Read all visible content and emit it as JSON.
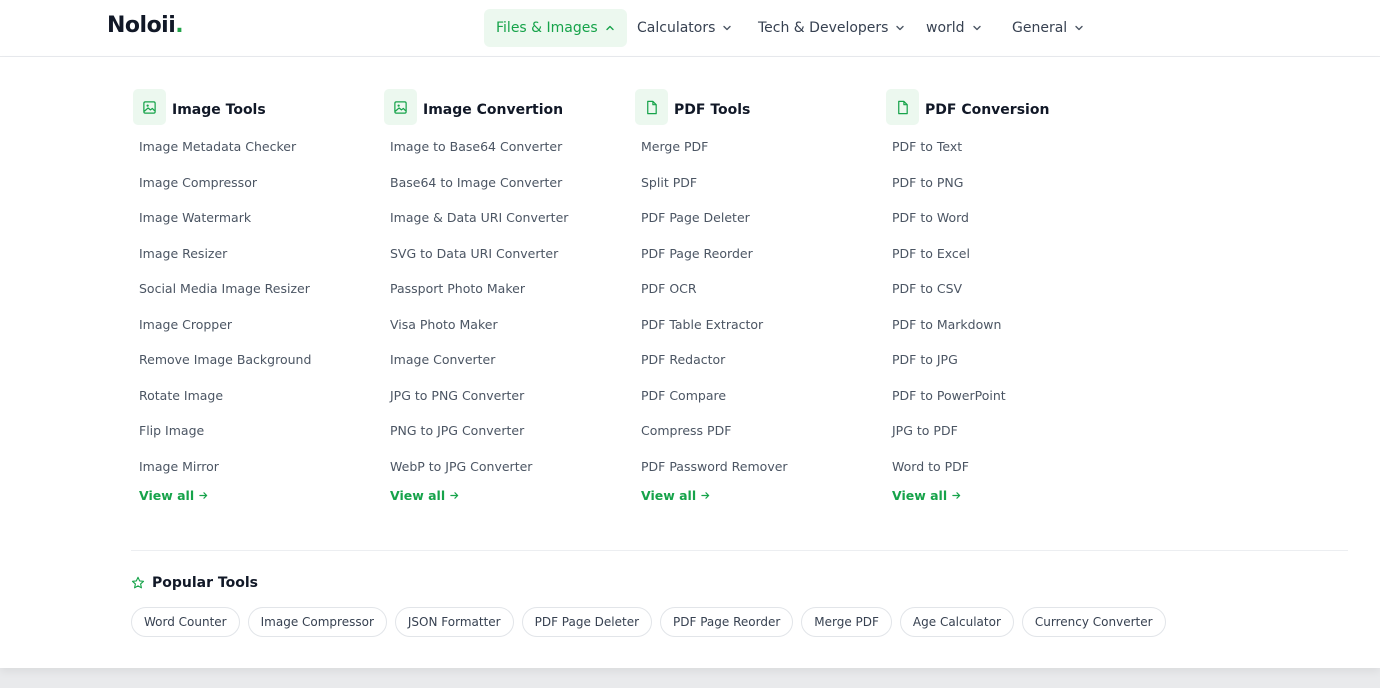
{
  "brand": {
    "name": "Noloii",
    "dot": "."
  },
  "nav": [
    {
      "label": "Files & Images",
      "active": true
    },
    {
      "label": "Calculators"
    },
    {
      "label": "Tech & Developers"
    },
    {
      "label": "world"
    },
    {
      "label": "General"
    }
  ],
  "columns": [
    {
      "title": "Image Tools",
      "icon": "image-icon",
      "links": [
        "Image Metadata Checker",
        "Image Compressor",
        "Image Watermark",
        "Image Resizer",
        "Social Media Image Resizer",
        "Image Cropper",
        "Remove Image Background",
        "Rotate Image",
        "Flip Image",
        "Image Mirror"
      ],
      "view_all": "View all"
    },
    {
      "title": "Image Convertion",
      "icon": "image-icon",
      "links": [
        "Image to Base64 Converter",
        "Base64 to Image Converter",
        "Image & Data URI Converter",
        "SVG to Data URI Converter",
        "Passport Photo Maker",
        "Visa Photo Maker",
        "Image Converter",
        "JPG to PNG Converter",
        "PNG to JPG Converter",
        "WebP to JPG Converter"
      ],
      "view_all": "View all"
    },
    {
      "title": "PDF Tools",
      "icon": "file-icon",
      "links": [
        "Merge PDF",
        "Split PDF",
        "PDF Page Deleter",
        "PDF Page Reorder",
        "PDF OCR",
        "PDF Table Extractor",
        "PDF Redactor",
        "PDF Compare",
        "Compress PDF",
        "PDF Password Remover"
      ],
      "view_all": "View all"
    },
    {
      "title": "PDF Conversion",
      "icon": "file-icon",
      "links": [
        "PDF to Text",
        "PDF to PNG",
        "PDF to Word",
        "PDF to Excel",
        "PDF to CSV",
        "PDF to Markdown",
        "PDF to JPG",
        "PDF to PowerPoint",
        "JPG to PDF",
        "Word to PDF"
      ],
      "view_all": "View all"
    }
  ],
  "popular": {
    "title": "Popular Tools",
    "icon": "star-icon",
    "chips": [
      "Word Counter",
      "Image Compressor",
      "JSON Formatter",
      "PDF Page Deleter",
      "PDF Page Reorder",
      "Merge PDF",
      "Age Calculator",
      "Currency Converter"
    ]
  },
  "colors": {
    "accent": "#16a34a",
    "accent_bg": "#ecf8ef",
    "text": "#4b5563"
  }
}
